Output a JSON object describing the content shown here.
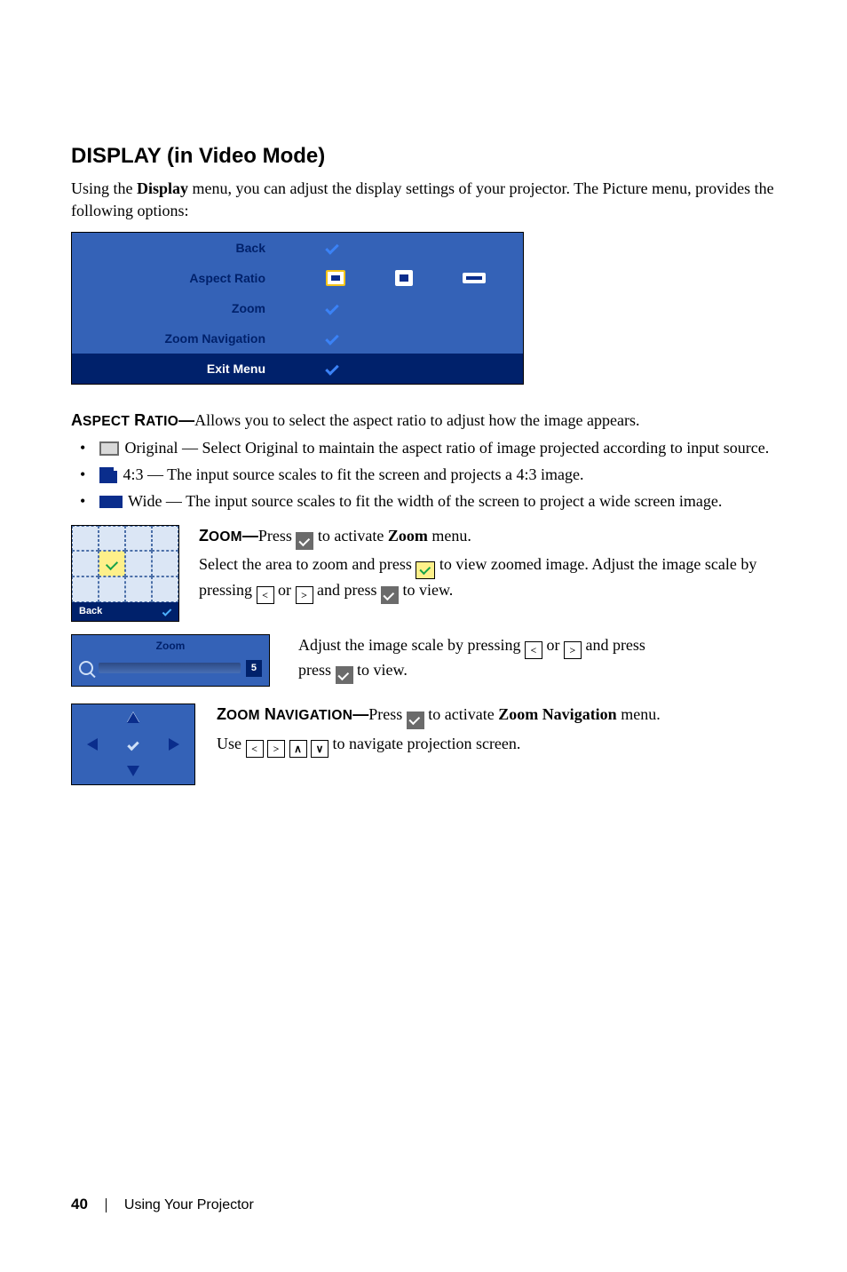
{
  "heading": "DISPLAY (in Video Mode)",
  "intro_before_bold": "Using the ",
  "intro_bold": "Display",
  "intro_after_bold": " menu, you can adjust the display settings of your projector. The Picture menu, provides the following options:",
  "osd": {
    "back": "Back",
    "aspect_ratio": "Aspect Ratio",
    "zoom": "Zoom",
    "zoom_navigation": "Zoom Navigation",
    "exit_menu": "Exit Menu"
  },
  "aspect_ratio_label_1": "A",
  "aspect_ratio_label_2": "SPECT",
  "aspect_ratio_label_3": " R",
  "aspect_ratio_label_4": "ATIO",
  "aspect_ratio_label_dash": "—",
  "aspect_ratio_desc": "Allows you to select the aspect ratio to adjust how the image appears.",
  "bullets": {
    "original": " Original — Select Original to maintain the aspect ratio of image projected according to input source.",
    "four_three": " 4:3 — The input source scales to fit the screen and projects a 4:3 image.",
    "wide": " Wide — The input source scales to fit the width of the screen to project a wide screen image."
  },
  "zoom_grid": {
    "back": "Back"
  },
  "zoom": {
    "label_1": "Z",
    "label_2": "OOM",
    "label_dash": "—",
    "press": "Press ",
    "activate_pre": " to activate ",
    "activate_bold": "Zoom",
    "activate_post": " menu.",
    "select_area_pre": "Select the area to zoom and press ",
    "select_area_post": " to view zoomed image.",
    "adjust_pre": "Adjust the image scale by pressing ",
    "adjust_or": " or ",
    "adjust_and": " and press ",
    "adjust_post": " to view."
  },
  "zoom_slider": {
    "title": "Zoom",
    "value": "5",
    "text_pre": "Adjust the image scale by pressing ",
    "text_or": " or ",
    "text_and": " and press ",
    "text_post": " to view."
  },
  "zoom_nav": {
    "label_1": "Z",
    "label_2": "OOM",
    "label_3": " N",
    "label_4": "AVIGATION",
    "label_dash": "—",
    "press": "Press ",
    "activate_pre": " to activate ",
    "activate_bold": "Zoom Navigation",
    "activate_post": " menu.",
    "use_pre": "Use ",
    "use_post": " to navigate projection screen."
  },
  "footer": {
    "page": "40",
    "section": "Using Your Projector"
  }
}
